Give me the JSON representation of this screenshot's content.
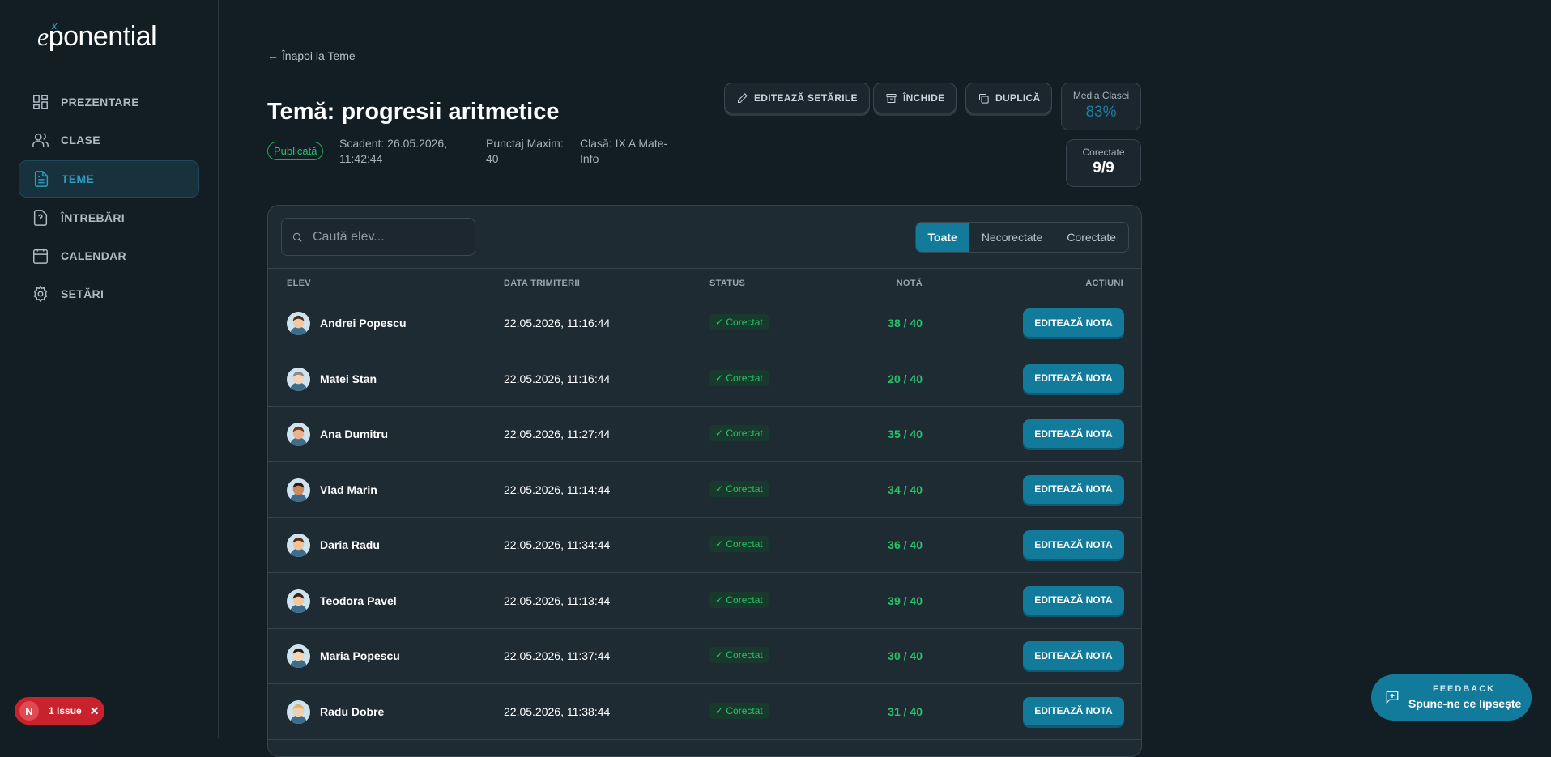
{
  "brand": {
    "e": "e",
    "x": "x",
    "rest": "ponential"
  },
  "nav": [
    {
      "label": "PREZENTARE",
      "icon": "dashboard-icon"
    },
    {
      "label": "CLASE",
      "icon": "users-icon"
    },
    {
      "label": "TEME",
      "icon": "document-icon",
      "active": true
    },
    {
      "label": "ÎNTREBĂRI",
      "icon": "question-icon"
    },
    {
      "label": "CALENDAR",
      "icon": "calendar-icon"
    },
    {
      "label": "SETĂRI",
      "icon": "gear-icon"
    }
  ],
  "header": {
    "back": "← Înapoi la Teme",
    "title": "Temă: progresii aritmetice",
    "badge": "Publicată",
    "due_l1": "Scadent: 26.05.2026,",
    "due_l2": "11:42:44",
    "max_l1": "Punctaj Maxim:",
    "max_l2": "40",
    "class_l1": "Clasă: IX A Mate-",
    "class_l2": "Info"
  },
  "actions": {
    "edit": "EDITEAZĂ SETĂRILE",
    "close": "ÎNCHIDE",
    "duplicate": "DUPLICĂ"
  },
  "stats": {
    "avg_label": "Media Clasei",
    "avg_value": "83%",
    "graded_label": "Corectate",
    "graded_value": "9/9"
  },
  "search": {
    "placeholder": "Caută elev..."
  },
  "filters": [
    "Toate",
    "Necorectate",
    "Corectate"
  ],
  "columns": {
    "student": "ELEV",
    "date": "DATA TRIMITERII",
    "status": "STATUS",
    "grade": "NOTĂ",
    "actions": "ACȚIUNI"
  },
  "rows": [
    {
      "name": "Andrei Popescu",
      "date": "22.05.2026, 11:16:44",
      "status": "Corectat",
      "grade": "38 / 40",
      "action": "EDITEAZĂ NOTA"
    },
    {
      "name": "Matei Stan",
      "date": "22.05.2026, 11:16:44",
      "status": "Corectat",
      "grade": "20 / 40",
      "action": "EDITEAZĂ NOTA"
    },
    {
      "name": "Ana Dumitru",
      "date": "22.05.2026, 11:27:44",
      "status": "Corectat",
      "grade": "35 / 40",
      "action": "EDITEAZĂ NOTA"
    },
    {
      "name": "Vlad Marin",
      "date": "22.05.2026, 11:14:44",
      "status": "Corectat",
      "grade": "34 / 40",
      "action": "EDITEAZĂ NOTA"
    },
    {
      "name": "Daria Radu",
      "date": "22.05.2026, 11:34:44",
      "status": "Corectat",
      "grade": "36 / 40",
      "action": "EDITEAZĂ NOTA"
    },
    {
      "name": "Teodora Pavel",
      "date": "22.05.2026, 11:13:44",
      "status": "Corectat",
      "grade": "39 / 40",
      "action": "EDITEAZĂ NOTA"
    },
    {
      "name": "Maria Popescu",
      "date": "22.05.2026, 11:37:44",
      "status": "Corectat",
      "grade": "30 / 40",
      "action": "EDITEAZĂ NOTA"
    },
    {
      "name": "Radu Dobre",
      "date": "22.05.2026, 11:38:44",
      "status": "Corectat",
      "grade": "31 / 40",
      "action": "EDITEAZĂ NOTA"
    }
  ],
  "issue": {
    "icon": "N",
    "label": "1 Issue",
    "close": "✕"
  },
  "feedback": {
    "kicker": "FEEDBACK",
    "message": "Spune-ne ce lipsește"
  },
  "colors": {
    "accent": "#127a9b",
    "success": "#2bc06a",
    "background": "#131d24",
    "panel": "#1f2b33"
  }
}
